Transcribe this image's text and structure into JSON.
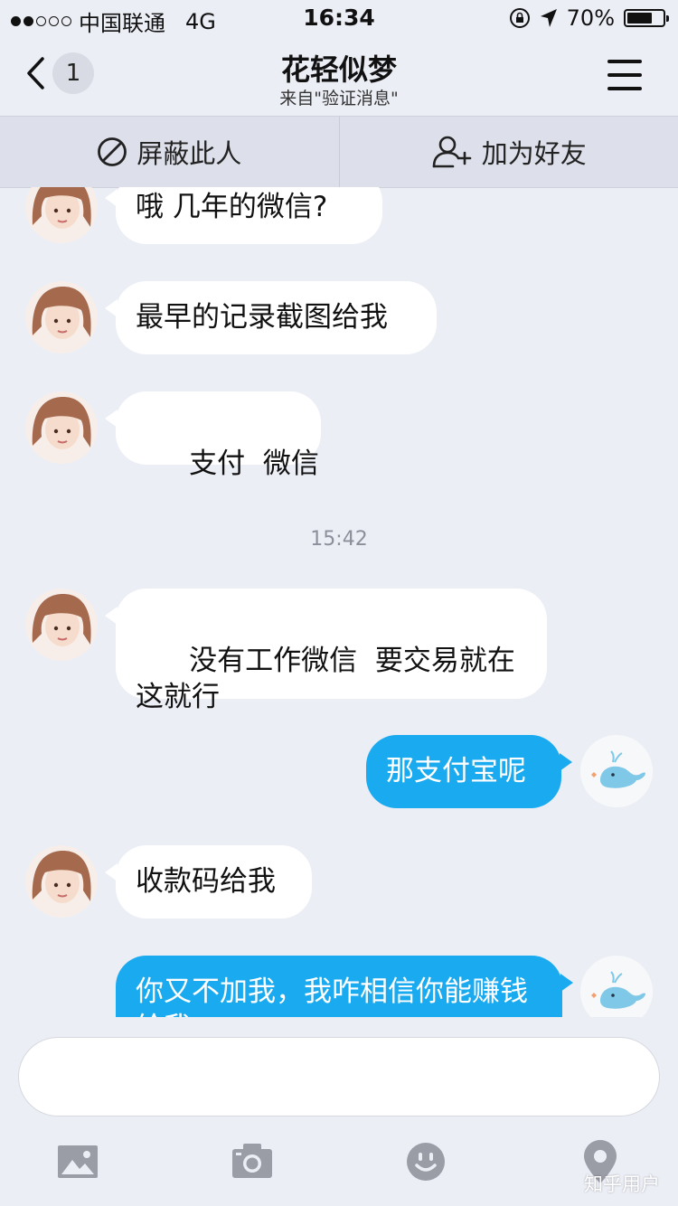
{
  "status_bar": {
    "carrier": "中国联通",
    "network": "4G",
    "time": "16:34",
    "battery_text": "70%",
    "battery_level": 0.7,
    "signal_bars_filled": 2,
    "signal_bars_total": 5
  },
  "nav": {
    "back_badge": "1",
    "title": "花轻似梦",
    "subtitle": "来自\"验证消息\""
  },
  "actions": {
    "block_label": "屏蔽此人",
    "add_friend_label": "加为好友"
  },
  "chat": {
    "time_separator": "15:42",
    "messages": [
      {
        "side": "in",
        "text": "哦 几年的微信?"
      },
      {
        "side": "in",
        "text": "最早的记录截图给我"
      },
      {
        "side": "in",
        "text": "支付  微信"
      },
      {
        "side": "in",
        "text": "没有工作微信  要交易就在这就行"
      },
      {
        "side": "out",
        "text": "那支付宝呢"
      },
      {
        "side": "in",
        "text": "收款码给我"
      },
      {
        "side": "out",
        "text": "你又不加我，我咋相信你能赚钱给我"
      }
    ]
  },
  "input": {
    "value": ""
  },
  "toolbar": {
    "items": [
      "image-icon",
      "camera-icon",
      "emoji-icon",
      "location-icon"
    ]
  },
  "watermark": "知乎用户",
  "colors": {
    "background": "#eceef6",
    "out_bubble": "#1aaaf0",
    "in_bubble": "#ffffff",
    "toolbar_icon": "#9a9ca6"
  }
}
